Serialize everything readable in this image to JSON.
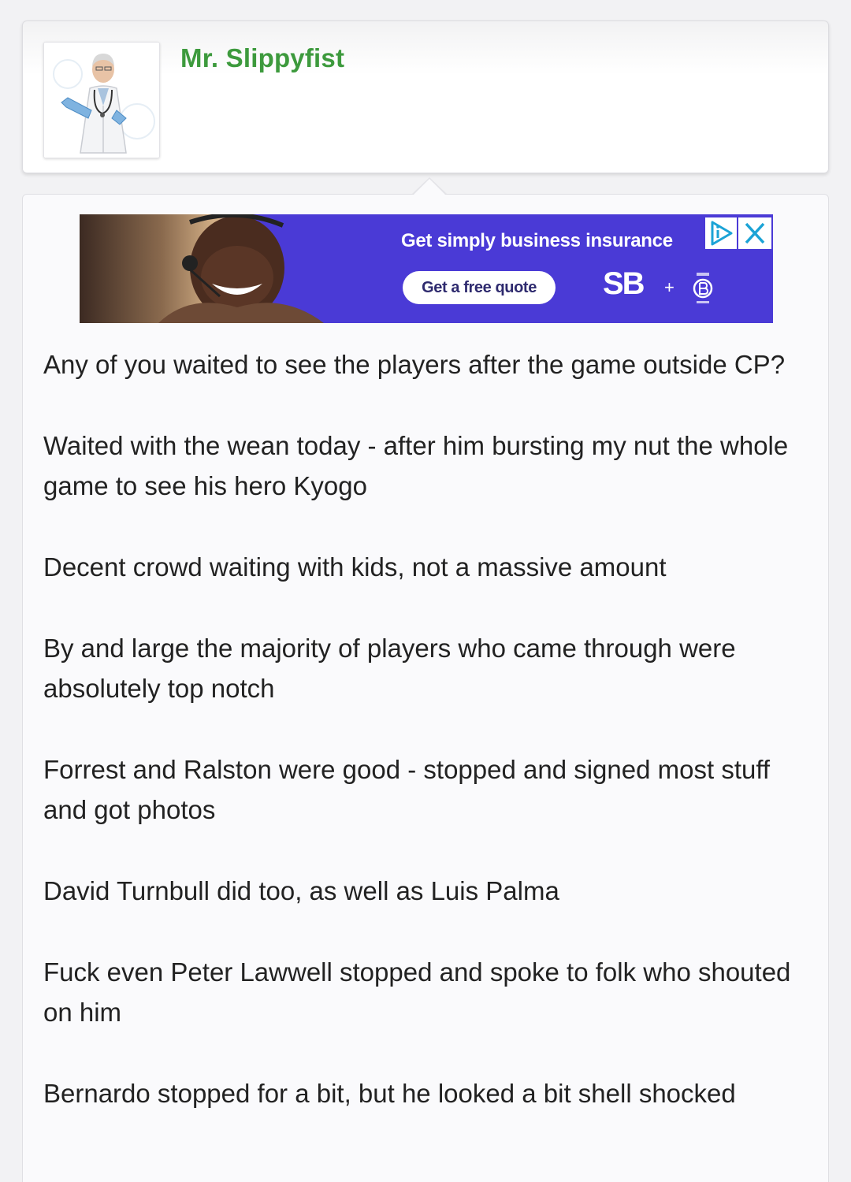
{
  "author": {
    "name": "Mr. Slippyfist",
    "name_color": "#3d9a3d"
  },
  "ad": {
    "headline": "Get simply business insurance",
    "cta_label": "Get a free quote",
    "logo_text": "SB",
    "plus": "+",
    "background": "#4a3ad6"
  },
  "post": {
    "paragraphs": [
      "Any of you waited to see the players after the game outside CP?",
      "Waited with the wean today - after him bursting my nut the whole game to see his hero Kyogo",
      "Decent crowd waiting with kids, not a massive amount",
      "By and large the majority of players who came through were absolutely top notch",
      "Forrest and Ralston were good - stopped and signed most stuff and got photos",
      "David Turnbull did too, as well as Luis Palma",
      "Fuck even Peter Lawwell stopped and spoke to folk who shouted on him",
      "Bernardo stopped for a bit, but he looked a bit shell shocked"
    ]
  }
}
